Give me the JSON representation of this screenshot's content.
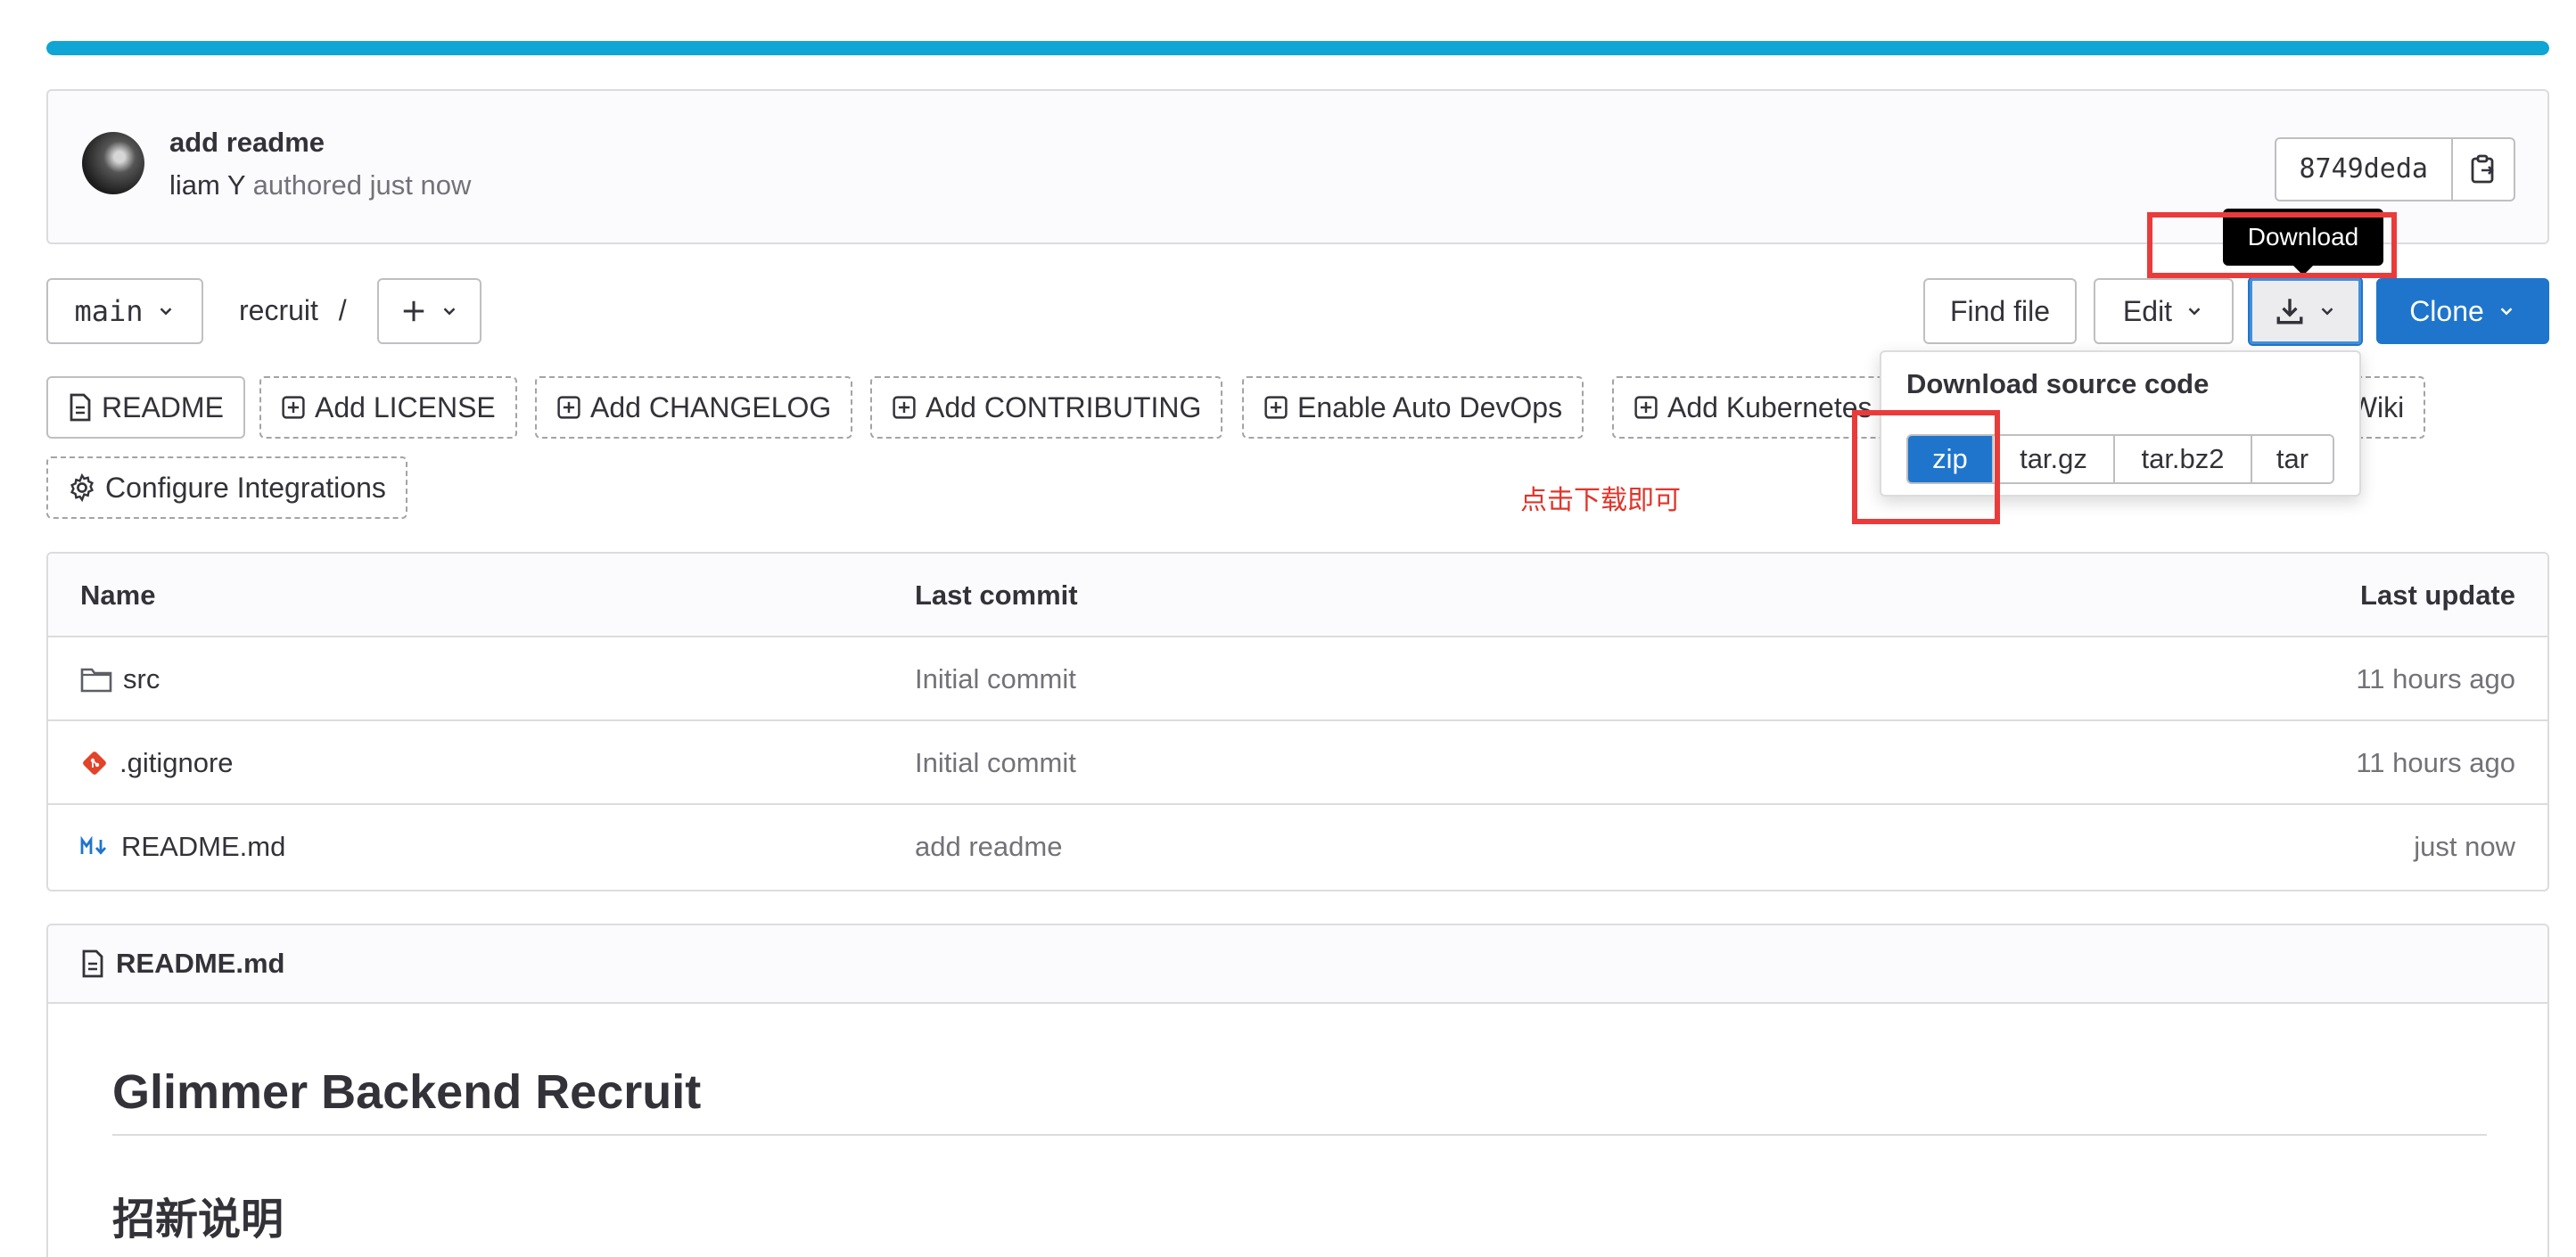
{
  "progress": {
    "fraction": 1.0,
    "color": "#0fa5d5"
  },
  "commit": {
    "title": "add readme",
    "author": "liam Y",
    "authored_text": "authored just now",
    "sha": "8749deda"
  },
  "toolbar": {
    "branch": "main",
    "path_repo": "recruit",
    "path_sep": "/",
    "find_file": "Find file",
    "edit": "Edit",
    "clone": "Clone",
    "download_tooltip": "Download"
  },
  "shortcuts": [
    {
      "label": "README",
      "icon": "document-icon"
    },
    {
      "label": "Add LICENSE",
      "icon": "plus-square-icon"
    },
    {
      "label": "Add CHANGELOG",
      "icon": "plus-square-icon"
    },
    {
      "label": "Add CONTRIBUTING",
      "icon": "plus-square-icon"
    },
    {
      "label": "Enable Auto DevOps",
      "icon": "plus-square-icon"
    },
    {
      "label": "Add Kubernetes",
      "icon": "plus-square-icon"
    },
    {
      "label": "Add Wiki",
      "icon": "plus-square-icon"
    },
    {
      "label": "Configure Integrations",
      "icon": "gear-icon"
    }
  ],
  "download_menu": {
    "title": "Download source code",
    "formats": [
      "zip",
      "tar.gz",
      "tar.bz2",
      "tar"
    ],
    "selected": "zip"
  },
  "annotation": {
    "note": "点击下载即可",
    "color": "#ea3b3b"
  },
  "file_table": {
    "headers": {
      "name": "Name",
      "last_commit": "Last commit",
      "last_update": "Last update"
    },
    "rows": [
      {
        "name": "src",
        "icon": "folder-icon",
        "commit": "Initial commit",
        "updated": "11 hours ago"
      },
      {
        "name": ".gitignore",
        "icon": "git-icon",
        "commit": "Initial commit",
        "updated": "11 hours ago"
      },
      {
        "name": "README.md",
        "icon": "markdown-icon",
        "commit": "add readme",
        "updated": "just now"
      }
    ]
  },
  "readme": {
    "filename": "README.md",
    "h1": "Glimmer Backend Recruit",
    "h2": "招新说明"
  },
  "colors": {
    "primary": "#1f75cb",
    "border": "#dcdcde",
    "muted": "#737278"
  }
}
